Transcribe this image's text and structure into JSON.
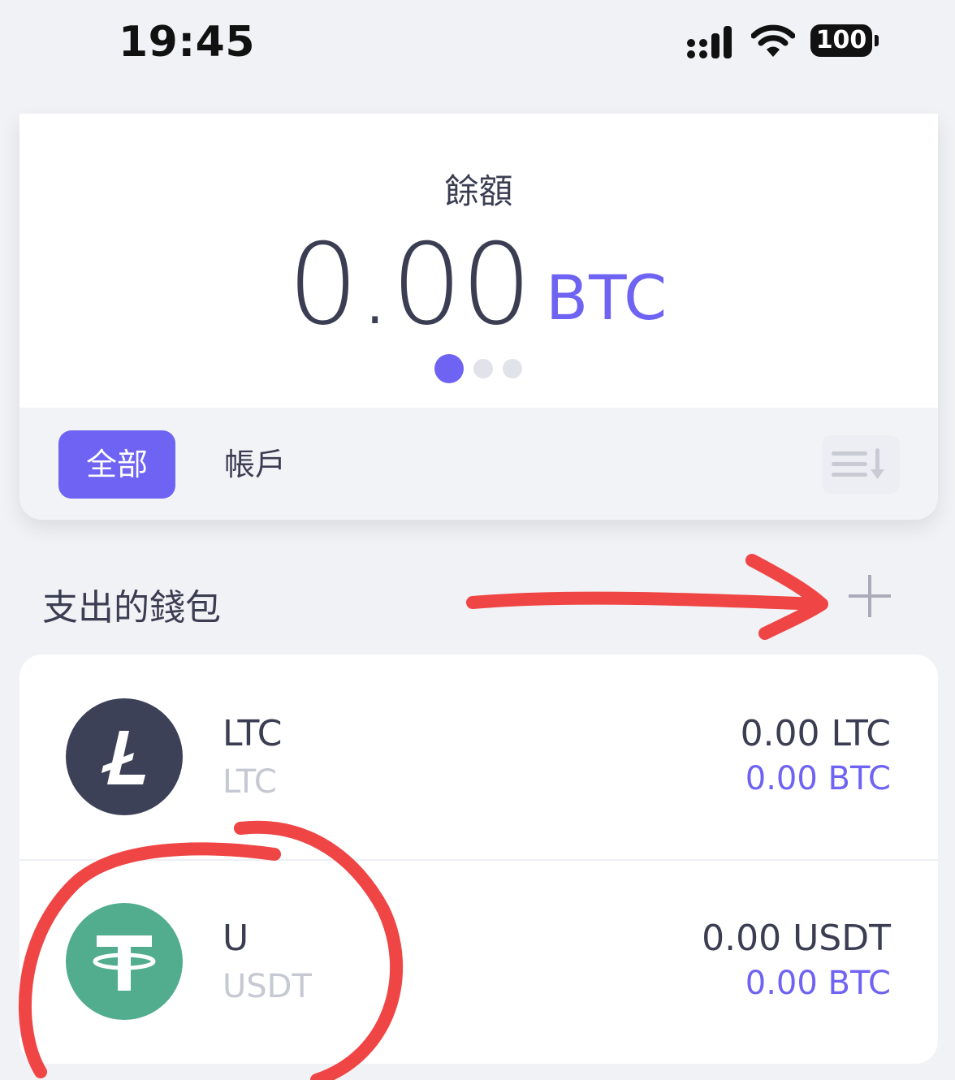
{
  "status_bar": {
    "time": "19:45",
    "battery": "100"
  },
  "balance": {
    "label": "餘額",
    "amount": "0.00",
    "unit": "BTC",
    "page_count": 3,
    "active_page": 1
  },
  "filters": {
    "all_label": "全部",
    "accounts_label": "帳戶"
  },
  "section": {
    "title": "支出的錢包"
  },
  "wallets": [
    {
      "name": "LTC",
      "symbol": "LTC",
      "amount": "0.00 LTC",
      "btc_value": "0.00 BTC",
      "icon": "litecoin-icon"
    },
    {
      "name": "U",
      "symbol": "USDT",
      "amount": "0.00 USDT",
      "btc_value": "0.00 BTC",
      "icon": "tether-icon"
    }
  ],
  "colors": {
    "accent": "#6e63f2",
    "text": "#3b3e52",
    "litecoin": "#3d4158",
    "tether": "#52ad8e",
    "annotation": "#f04545"
  }
}
